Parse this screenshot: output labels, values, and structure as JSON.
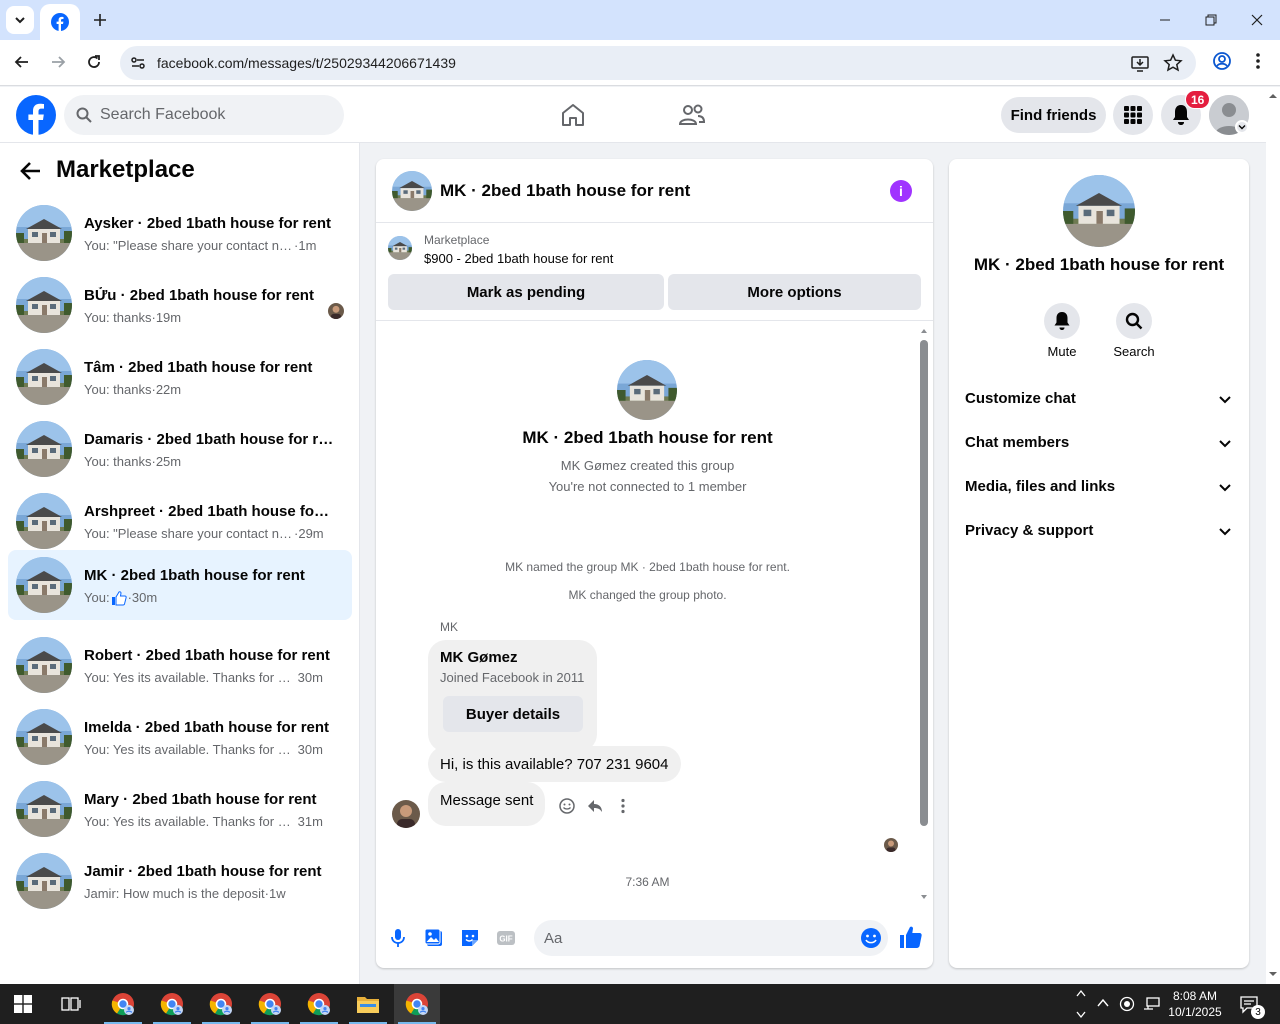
{
  "browser": {
    "url": "facebook.com/messages/t/25029344206671439"
  },
  "fb_header": {
    "search_placeholder": "Search Facebook",
    "find_friends": "Find friends",
    "notification_count": "16"
  },
  "sidebar": {
    "title": "Marketplace",
    "conversations": [
      {
        "name": "Aysker · 2bed 1bath house for rent",
        "preview": "You: \"Please share your contact num...",
        "time": "1m"
      },
      {
        "name": "BỬu · 2bed 1bath house for rent",
        "preview": "You: thanks",
        "time": "19m"
      },
      {
        "name": "Tâm · 2bed 1bath house for rent",
        "preview": "You: thanks",
        "time": "22m"
      },
      {
        "name": "Damaris · 2bed 1bath house for rent",
        "preview": "You: thanks",
        "time": "25m"
      },
      {
        "name": "Arshpreet · 2bed 1bath house for r...",
        "preview": "You: \"Please share your contact nu...",
        "time": "29m"
      },
      {
        "name": "MK · 2bed 1bath house for rent",
        "preview": "You:",
        "time": "30m"
      },
      {
        "name": "Robert · 2bed 1bath house for rent",
        "preview": "You: Yes its available. Thanks for me...",
        "time": "30m"
      },
      {
        "name": "Imelda · 2bed 1bath house for rent",
        "preview": "You: Yes its available. Thanks for me...",
        "time": "30m"
      },
      {
        "name": "Mary · 2bed 1bath house for rent",
        "preview": "You: Yes its available. Thanks for me...",
        "time": "31m"
      },
      {
        "name": "Jamir · 2bed 1bath house for rent",
        "preview": "Jamir: How much is the deposit",
        "time": "1w"
      }
    ]
  },
  "chat": {
    "title": "MK · 2bed 1bath house for rent",
    "listing_kicker": "Marketplace",
    "listing_title": "$900 - 2bed 1bath house for rent",
    "mark_pending": "Mark as pending",
    "more_options": "More options",
    "group_name": "MK · 2bed 1bath house for rent",
    "created_by": "MK Gømez created this group",
    "not_connected": "You're not connected to 1 member",
    "named_event": "MK named the group MK · 2bed 1bath house for rent.",
    "photo_event": "MK changed the group photo.",
    "sender_label": "MK",
    "card_name": "MK Gømez",
    "card_joined": "Joined Facebook in 2011",
    "buyer_details": "Buyer details",
    "message_1": "Hi, is this available? 707 231 9604",
    "message_2": "Message sent",
    "timestamp": "7:36 AM",
    "composer_placeholder": "Aa"
  },
  "info_panel": {
    "name": "MK · 2bed 1bath house for rent",
    "mute": "Mute",
    "search": "Search",
    "sections": [
      "Customize chat",
      "Chat members",
      "Media, files and links",
      "Privacy & support"
    ]
  },
  "taskbar": {
    "time": "8:08 AM",
    "date": "10/1/2025",
    "notifications": "3"
  },
  "colors": {
    "facebook_blue": "#0866ff",
    "active_row": "#e7f3ff",
    "info_purple": "#a033ff",
    "badge_red": "#e41e3f"
  }
}
